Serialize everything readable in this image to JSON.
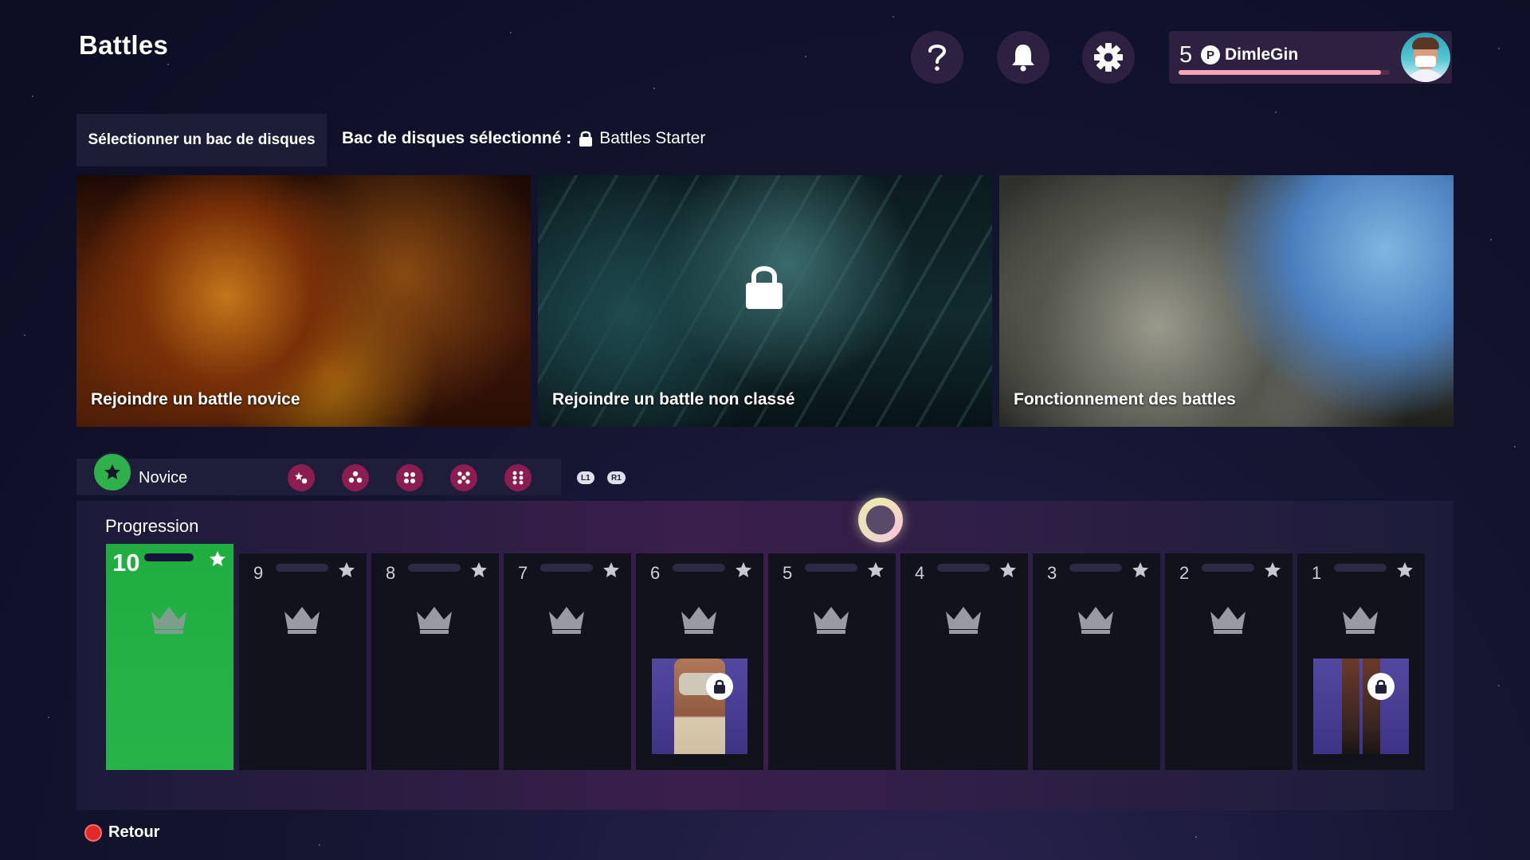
{
  "page": {
    "title": "Battles"
  },
  "header": {
    "help_icon": "question-icon",
    "notifications_icon": "bell-icon",
    "settings_icon": "gear-icon",
    "profile": {
      "level": "5",
      "username": "DimleGin",
      "xp_progress": 0.96,
      "progress_color": "#f7a6b7"
    }
  },
  "crate": {
    "select_label": "Sélectionner un bac de disques",
    "selected_label": "Bac de disques sélectionné :",
    "selected_value": "Battles Starter"
  },
  "modes": [
    {
      "label": "Rejoindre un battle novice",
      "locked": false
    },
    {
      "label": "Rejoindre un battle non classé",
      "locked": true
    },
    {
      "label": "Fonctionnement des battles",
      "locked": false
    }
  ],
  "tiers": {
    "current": "Novice",
    "current_color": "#2eb04b",
    "tier_color": "#8c1d50",
    "buttons": [
      "L1",
      "R1"
    ]
  },
  "progression": {
    "title": "Progression",
    "active_color": "#28b34a",
    "slots": [
      {
        "number": "10",
        "active": true
      },
      {
        "number": "9"
      },
      {
        "number": "8"
      },
      {
        "number": "7"
      },
      {
        "number": "6",
        "reward": "outfit-top",
        "reward_locked": true
      },
      {
        "number": "5"
      },
      {
        "number": "4"
      },
      {
        "number": "3"
      },
      {
        "number": "2"
      },
      {
        "number": "1",
        "reward": "outfit-bottom",
        "reward_locked": true
      }
    ]
  },
  "footer": {
    "back_label": "Retour",
    "back_button_color": "#e02a2a"
  }
}
